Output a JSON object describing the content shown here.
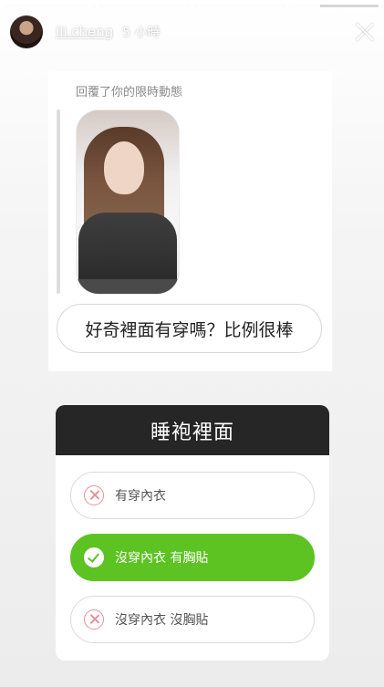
{
  "story": {
    "progress_segments": [
      1,
      1,
      1,
      0.35
    ],
    "username": "ili.cheng",
    "time_ago": "5 小時"
  },
  "reply": {
    "caption": "回覆了你的限時動態",
    "message": "好奇裡面有穿嗎？比例很棒"
  },
  "poll": {
    "question": "睡袍裡面",
    "options": [
      {
        "label": "有穿內衣",
        "state": "wrong"
      },
      {
        "label": "沒穿內衣 有胸貼",
        "state": "correct"
      },
      {
        "label": "沒穿內衣 沒胸貼",
        "state": "wrong"
      }
    ]
  },
  "colors": {
    "poll_correct": "#5cc323",
    "poll_wrong_icon": "#e8909a",
    "poll_header_bg": "#262626"
  },
  "icons": {
    "close": "close-icon",
    "wrong": "x-circle-icon",
    "correct": "check-circle-icon"
  }
}
